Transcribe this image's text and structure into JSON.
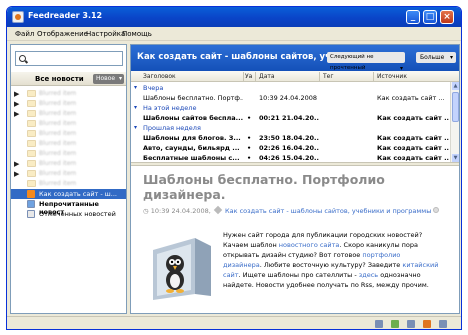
{
  "window": {
    "title": "Feedreader 3.12",
    "minimize_glyph": "_",
    "maximize_glyph": "□",
    "close_glyph": "×"
  },
  "menu": [
    "Файл",
    "Отображение",
    "Настройка",
    "Помощь"
  ],
  "left_panel": {
    "search_placeholder": "",
    "title": "Все новости",
    "mode": "Новое",
    "tree": [
      {
        "label": "Blurred item",
        "arrow": "▶",
        "type": "blurred"
      },
      {
        "label": "Blurred item",
        "arrow": "▶",
        "type": "blurred"
      },
      {
        "label": "Blurred item",
        "arrow": "▶",
        "type": "blurred"
      },
      {
        "label": "Blurred item",
        "arrow": "",
        "type": "blurred"
      },
      {
        "label": "Blurred item",
        "arrow": "",
        "type": "blurred"
      },
      {
        "label": "Blurred item",
        "arrow": "",
        "type": "blurred"
      },
      {
        "label": "Blurred item",
        "arrow": "",
        "type": "blurred"
      },
      {
        "label": "Blurred item",
        "arrow": "▶",
        "type": "blurred"
      },
      {
        "label": "Blurred item",
        "arrow": "▶",
        "type": "blurred"
      },
      {
        "label": "Blurred item",
        "arrow": "",
        "type": "blurred"
      },
      {
        "label": "Как создать сайт - ш...",
        "arrow": "",
        "type": "selected"
      },
      {
        "label": "Непрочитанные новост",
        "arrow": "",
        "type": "bold"
      },
      {
        "label": "Отмеченных новостей",
        "arrow": "",
        "type": "plain"
      }
    ]
  },
  "feed": {
    "title": "Как создать сайт - шаблоны сайтов, уч",
    "next_unread": "Следующий не прочтенный",
    "more": "Больше",
    "columns": [
      "Заголовок",
      "Уа",
      "Дата",
      "Тег",
      "Источник"
    ],
    "groups": [
      {
        "label": "Вчера",
        "rows": [
          {
            "title": "Шаблоны бесплатно. Портф...",
            "flag": "",
            "date": "10:39 24.04.2008",
            "tag": "",
            "source": "Как создать сайт ...",
            "bold": false
          }
        ]
      },
      {
        "label": "На этой неделе",
        "rows": [
          {
            "title": "Шаблоны сайтов беспла...",
            "flag": "•",
            "date": "00:21 21.04.20...",
            "tag": "",
            "source": "Как создать сайт ...",
            "bold": true
          }
        ]
      },
      {
        "label": "Прошлая неделя",
        "rows": [
          {
            "title": "Шаблоны для блогов. З...",
            "flag": "•",
            "date": "23:50 18.04.20...",
            "tag": "",
            "source": "Как создать сайт ...",
            "bold": true
          },
          {
            "title": "Авто, саунды, бильярд ...",
            "flag": "•",
            "date": "02:26 16.04.20...",
            "tag": "",
            "source": "Как создать сайт ...",
            "bold": true
          },
          {
            "title": "Бесплатные шаблоны с...",
            "flag": "•",
            "date": "04:26 15.04.20...",
            "tag": "",
            "source": "Как создать сайт ...",
            "bold": true
          }
        ]
      }
    ]
  },
  "article": {
    "title": "Шаблоны бесплатно. Портфолио дизайнера.",
    "meta_time": "10:39 24.04.2008,",
    "meta_source": "Как создать сайт - шаблоны сайтов, учебники и программы",
    "text_parts": [
      {
        "t": "Нужен сайт города для публикации городских новостей? Качаем шаблон ",
        "link": false
      },
      {
        "t": "новостного сайта",
        "link": true
      },
      {
        "t": ". Скоро каникулы пора открывать дизайн студию? Вот готовое ",
        "link": false
      },
      {
        "t": "портфолио дизайнера",
        "link": true
      },
      {
        "t": ". Любите восточную культуру? Заведите ",
        "link": false
      },
      {
        "t": "китайский сайт",
        "link": true
      },
      {
        "t": ". Ищете шаблоны про сателлиты - ",
        "link": false
      },
      {
        "t": "здесь",
        "link": true
      },
      {
        "t": " однозначно найдете. Новости удобнее получать по Rss, между прочим.",
        "link": false
      }
    ]
  },
  "colors": {
    "titlebar": "#0A44C8",
    "feed_header": "#1450B8",
    "group_label": "#1B48B8",
    "link": "#3A6DC9",
    "selection": "#316AC5"
  }
}
